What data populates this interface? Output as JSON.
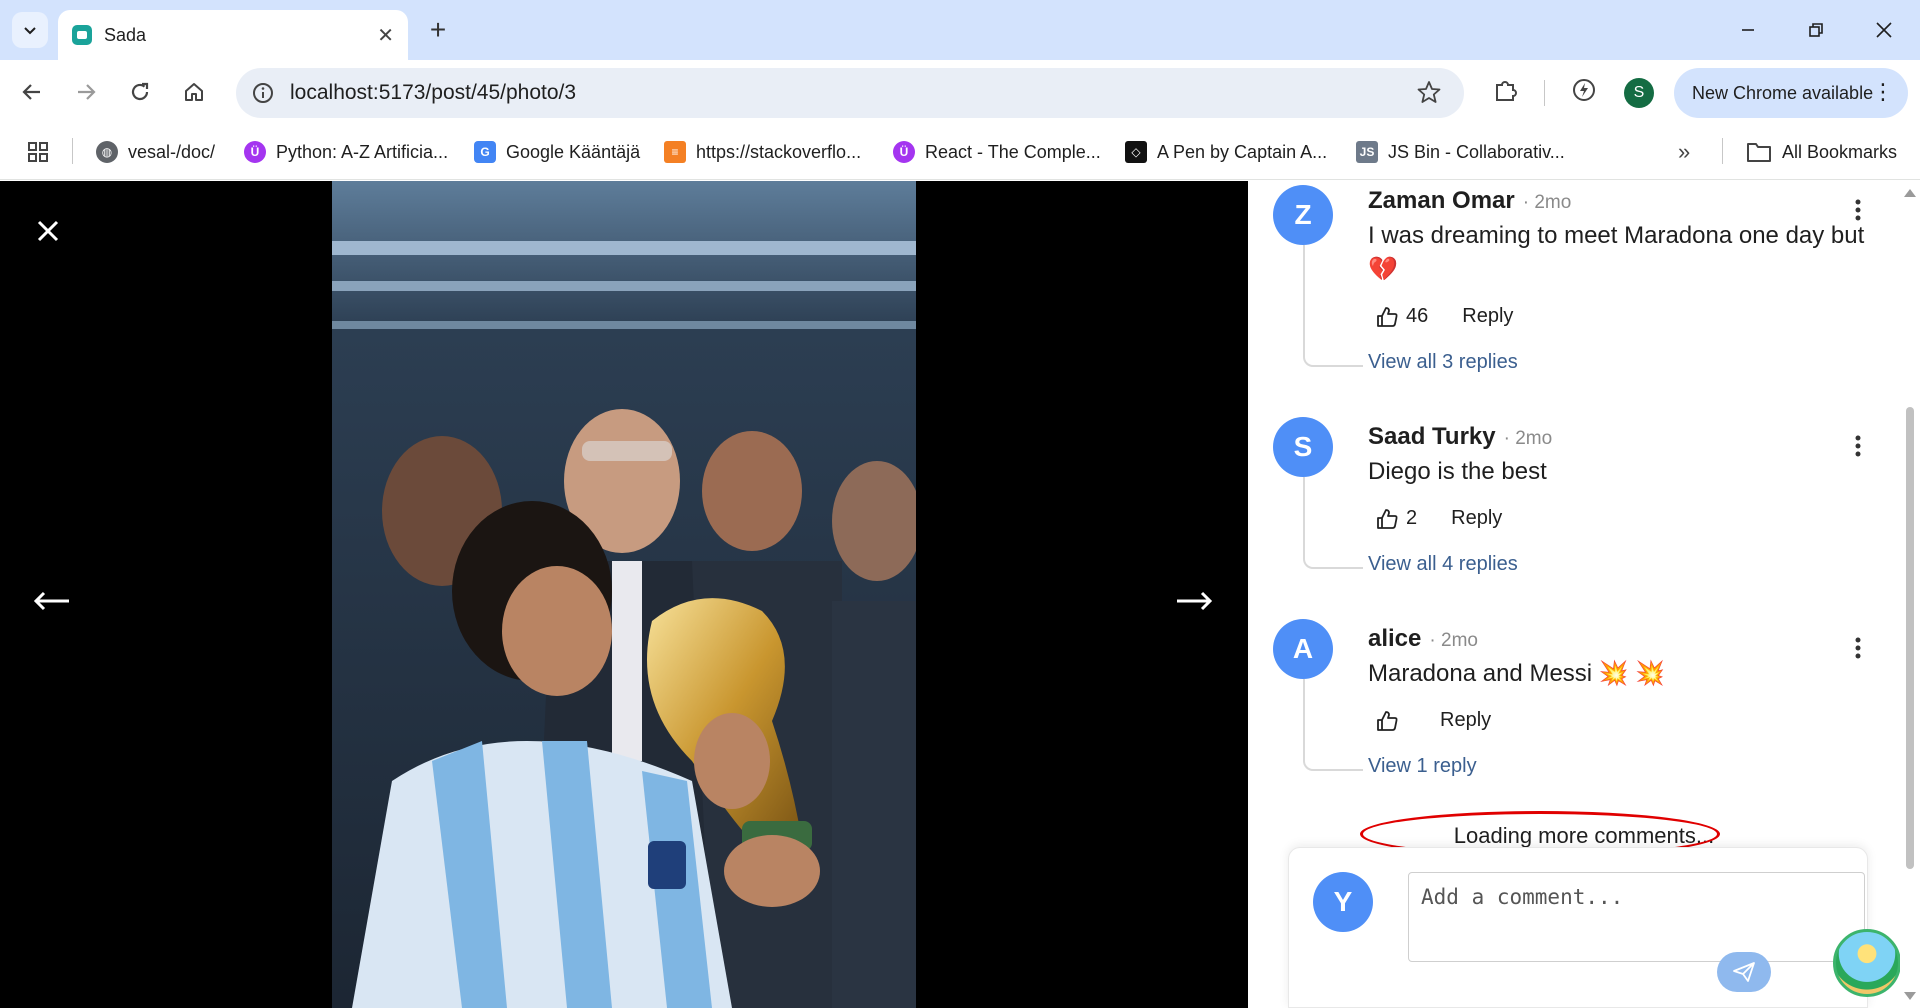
{
  "browser": {
    "tab_title": "Sada",
    "url": "localhost:5173/post/45/photo/3",
    "profile_initial": "S",
    "update_label": "New Chrome available",
    "bookmarks": [
      {
        "label": "vesal-/doc/",
        "icon": "globe-icon"
      },
      {
        "label": "Python: A-Z Artificia...",
        "icon": "udemy-icon"
      },
      {
        "label": "Google Kääntäjä",
        "icon": "google-translate-icon"
      },
      {
        "label": "https://stackoverflo...",
        "icon": "stackoverflow-icon"
      },
      {
        "label": "React - The Comple...",
        "icon": "udemy-icon"
      },
      {
        "label": "A Pen by Captain A...",
        "icon": "codepen-icon"
      },
      {
        "label": "JS Bin - Collaborativ...",
        "icon": "jsbin-icon"
      }
    ],
    "all_bookmarks_label": "All Bookmarks"
  },
  "viewer": {
    "photo_alt": "Maradona kissing the World Cup trophy",
    "close_icon": "close-icon",
    "prev_icon": "arrow-left-icon",
    "next_icon": "arrow-right-icon"
  },
  "comments": [
    {
      "initial": "Z",
      "author": "Zaman Omar",
      "time": "· 2mo",
      "text": "I was dreaming to meet Maradona one day but 💔",
      "likes": "46",
      "reply_label": "Reply",
      "view_replies": "View all 3 replies"
    },
    {
      "initial": "S",
      "author": "Saad Turky",
      "time": "· 2mo",
      "text": "Diego is the best",
      "likes": "2",
      "reply_label": "Reply",
      "view_replies": "View all 4 replies"
    },
    {
      "initial": "A",
      "author": "alice",
      "time": "· 2mo",
      "text": "Maradona and Messi 💥 💥",
      "likes": "",
      "reply_label": "Reply",
      "view_replies": "View 1 reply"
    }
  ],
  "loading_text": "Loading more comments...",
  "composer": {
    "user_initial": "Y",
    "placeholder": "Add a comment..."
  },
  "colors": {
    "avatar": "#4f8ff7",
    "link": "#3b5f8f",
    "highlight": "#e00000"
  }
}
